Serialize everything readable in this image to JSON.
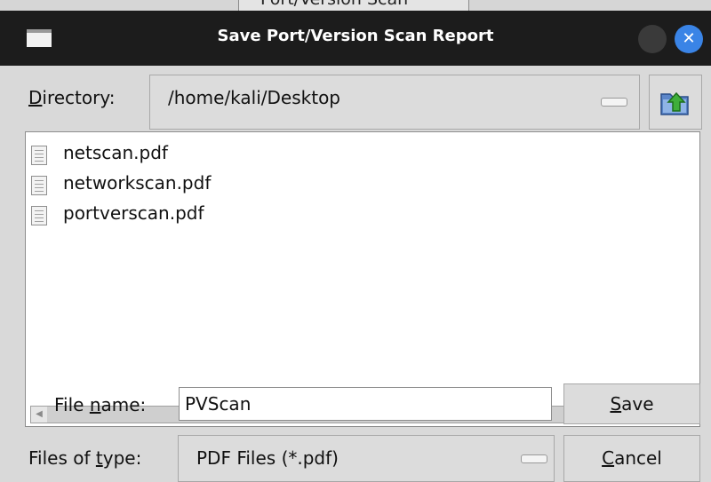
{
  "background_window": {
    "tab_title": "Port/Version Scan"
  },
  "window": {
    "title": "Save Port/Version Scan Report",
    "icon": "window-icon",
    "colors": {
      "titlebar": "#1c1c1c",
      "close_button": "#3a84e6"
    }
  },
  "directory": {
    "label_prefix": "D",
    "label_rest": "irectory:",
    "value": "/home/kali/Desktop",
    "up_icon": "folder-up-icon"
  },
  "files": [
    {
      "name": "netscan.pdf",
      "icon": "document-icon"
    },
    {
      "name": "networkscan.pdf",
      "icon": "document-icon"
    },
    {
      "name": "portverscan.pdf",
      "icon": "document-icon"
    }
  ],
  "filename": {
    "label_before": "File ",
    "label_mnemonic": "n",
    "label_after": "ame:",
    "value": "PVScan"
  },
  "filetype": {
    "label_before": "Files of ",
    "label_mnemonic": "t",
    "label_after": "ype:",
    "value": "PDF Files (*.pdf)"
  },
  "buttons": {
    "save_mnemonic": "S",
    "save_rest": "ave",
    "cancel_mnemonic": "C",
    "cancel_rest": "ancel"
  }
}
